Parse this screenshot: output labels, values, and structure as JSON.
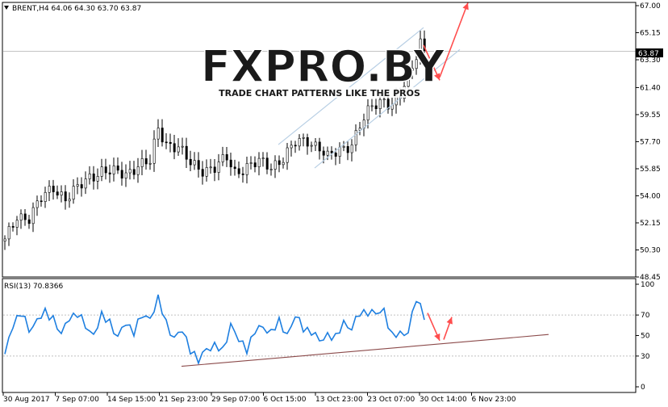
{
  "main_panel": {
    "header": "BRENT,H4  64.06 64.30 63.70 63.87",
    "current_price_label": "63.87"
  },
  "rsi_panel": {
    "header": "RSI(13) 70.8366"
  },
  "watermark": {
    "logo_text": "FXPRO.BY",
    "tagline": "TRADE CHART PATTERNS LIKE THE PROS"
  },
  "colors": {
    "background": "#ffffff",
    "bull_candle": "#ffffff",
    "bear_candle": "#000000",
    "rsi_line": "#1e7fe0",
    "channel_lines": "#b8cfe4",
    "trend_line": "#8b4a4a",
    "arrows": "#ff4d4d",
    "grid_text": "#000000"
  },
  "chart_data": [
    {
      "type": "candlestick",
      "title": "BRENT,H4",
      "ohlc_last": {
        "open": 64.06,
        "high": 64.3,
        "low": 63.7,
        "close": 63.87
      },
      "y_ticks": [
        "67.00",
        "65.15",
        "63.30",
        "61.40",
        "59.55",
        "57.70",
        "55.85",
        "54.00",
        "52.15",
        "50.30",
        "48.45"
      ],
      "ylim": [
        48.45,
        67.0
      ],
      "x_ticks": [
        "30 Aug 2017",
        "7 Sep 07:00",
        "14 Sep 15:00",
        "21 Sep 23:00",
        "29 Sep 07:00",
        "6 Oct 15:00",
        "13 Oct 23:00",
        "23 Oct 07:00",
        "30 Oct 14:00",
        "6 Nov 23:00"
      ],
      "close_path": [
        [
          0,
          50.9
        ],
        [
          3,
          52.6
        ],
        [
          6,
          52.5
        ],
        [
          9,
          53.8
        ],
        [
          12,
          54.6
        ],
        [
          15,
          53.8
        ],
        [
          18,
          54.5
        ],
        [
          21,
          55.3
        ],
        [
          24,
          55.7
        ],
        [
          27,
          55.6
        ],
        [
          30,
          55.5
        ],
        [
          33,
          56.1
        ],
        [
          36,
          56.3
        ],
        [
          38,
          58.6
        ],
        [
          40,
          57.6
        ],
        [
          43,
          57.3
        ],
        [
          46,
          56.2
        ],
        [
          49,
          55.8
        ],
        [
          52,
          55.9
        ],
        [
          55,
          56.6
        ],
        [
          57,
          55.6
        ],
        [
          60,
          56.0
        ],
        [
          63,
          56.3
        ],
        [
          66,
          56.0
        ],
        [
          69,
          56.6
        ],
        [
          72,
          57.6
        ],
        [
          75,
          57.8
        ],
        [
          78,
          57.3
        ],
        [
          80,
          56.6
        ],
        [
          83,
          57.1
        ],
        [
          86,
          57.6
        ],
        [
          88,
          58.8
        ],
        [
          91,
          60.1
        ],
        [
          94,
          60.6
        ],
        [
          96,
          60.2
        ],
        [
          98,
          60.8
        ],
        [
          101,
          62.8
        ],
        [
          103,
          64.6
        ],
        [
          104,
          63.9
        ]
      ],
      "channel": {
        "upper": [
          [
            68,
            57.5
          ],
          [
            104,
            65.5
          ]
        ],
        "lower": [
          [
            77,
            55.9
          ],
          [
            113,
            64.0
          ]
        ]
      },
      "arrow_down": {
        "from": [
          104,
          64.3
        ],
        "to": [
          108,
          61.9
        ]
      },
      "arrow_up": {
        "from": [
          108,
          62.1
        ],
        "to": [
          115,
          67.2
        ]
      }
    },
    {
      "type": "line",
      "title": "RSI(13)",
      "y_ticks": [
        "100",
        "70",
        "50",
        "30",
        "0"
      ],
      "ylim": [
        0,
        100
      ],
      "values_path": [
        [
          0,
          30
        ],
        [
          2,
          62
        ],
        [
          4,
          72
        ],
        [
          6,
          55
        ],
        [
          8,
          66
        ],
        [
          10,
          71
        ],
        [
          12,
          68
        ],
        [
          14,
          50
        ],
        [
          16,
          68
        ],
        [
          18,
          72
        ],
        [
          20,
          58
        ],
        [
          22,
          52
        ],
        [
          24,
          68
        ],
        [
          26,
          64
        ],
        [
          28,
          48
        ],
        [
          30,
          62
        ],
        [
          32,
          55
        ],
        [
          34,
          68
        ],
        [
          36,
          68
        ],
        [
          38,
          85
        ],
        [
          40,
          62
        ],
        [
          42,
          48
        ],
        [
          44,
          54
        ],
        [
          46,
          38
        ],
        [
          48,
          24
        ],
        [
          50,
          38
        ],
        [
          52,
          40
        ],
        [
          54,
          34
        ],
        [
          56,
          62
        ],
        [
          58,
          44
        ],
        [
          60,
          38
        ],
        [
          62,
          54
        ],
        [
          64,
          58
        ],
        [
          66,
          54
        ],
        [
          68,
          62
        ],
        [
          70,
          52
        ],
        [
          72,
          68
        ],
        [
          74,
          58
        ],
        [
          76,
          54
        ],
        [
          78,
          44
        ],
        [
          80,
          52
        ],
        [
          82,
          46
        ],
        [
          84,
          64
        ],
        [
          86,
          56
        ],
        [
          88,
          72
        ],
        [
          90,
          74
        ],
        [
          92,
          70
        ],
        [
          94,
          76
        ],
        [
          96,
          48
        ],
        [
          98,
          52
        ],
        [
          100,
          54
        ],
        [
          102,
          85
        ],
        [
          104,
          71
        ]
      ],
      "trend_line": [
        [
          44,
          20
        ],
        [
          135,
          51
        ]
      ],
      "arrow_down": {
        "from": [
          105,
          72
        ],
        "to": [
          108,
          45
        ]
      },
      "arrow_up": {
        "from": [
          109,
          46
        ],
        "to": [
          111,
          68
        ]
      }
    }
  ]
}
